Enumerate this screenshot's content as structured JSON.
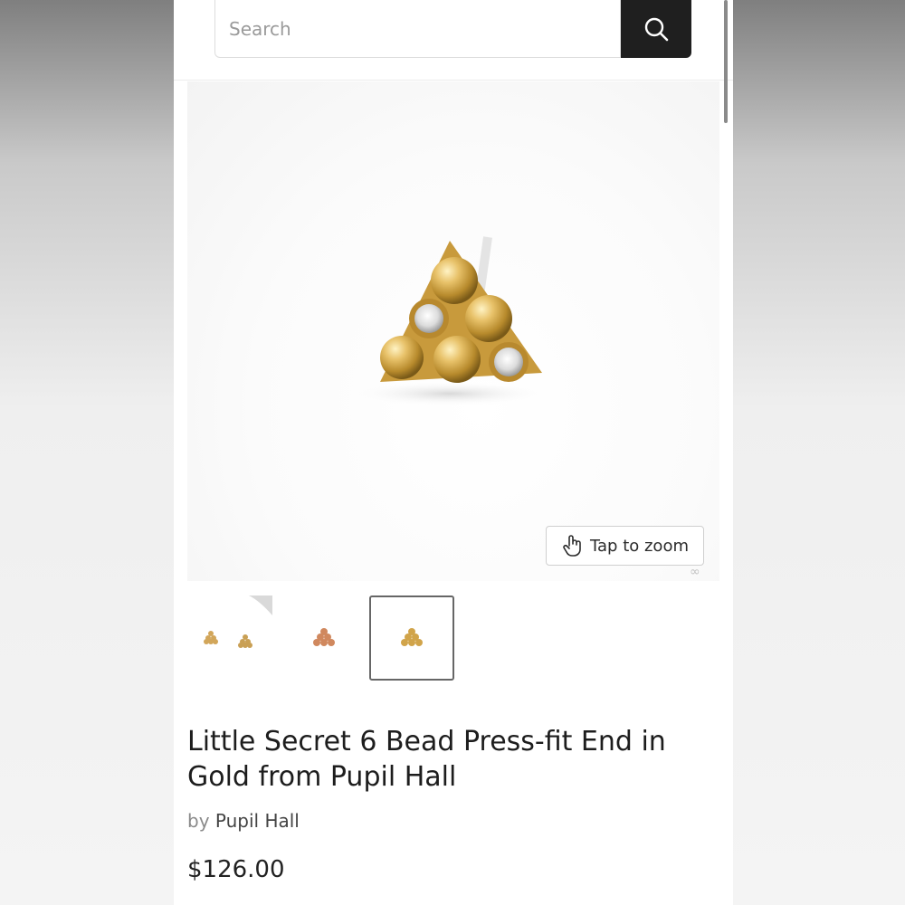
{
  "search": {
    "placeholder": "Search"
  },
  "icons": {
    "search": "search-icon",
    "zoom": "tap-hand-icon",
    "watermark": "infinity-logo-icon"
  },
  "colors": {
    "search_button": "#1f1f1f",
    "gold": "#d4a84a"
  },
  "gallery": {
    "zoom_label": "Tap to zoom",
    "thumbnail_count": 3,
    "selected_thumbnail": 3
  },
  "product": {
    "title": "Little Secret 6 Bead Press-fit End in Gold from Pupil Hall",
    "vendor_prefix": "by",
    "vendor": "Pupil Hall",
    "price": "$126.00"
  }
}
